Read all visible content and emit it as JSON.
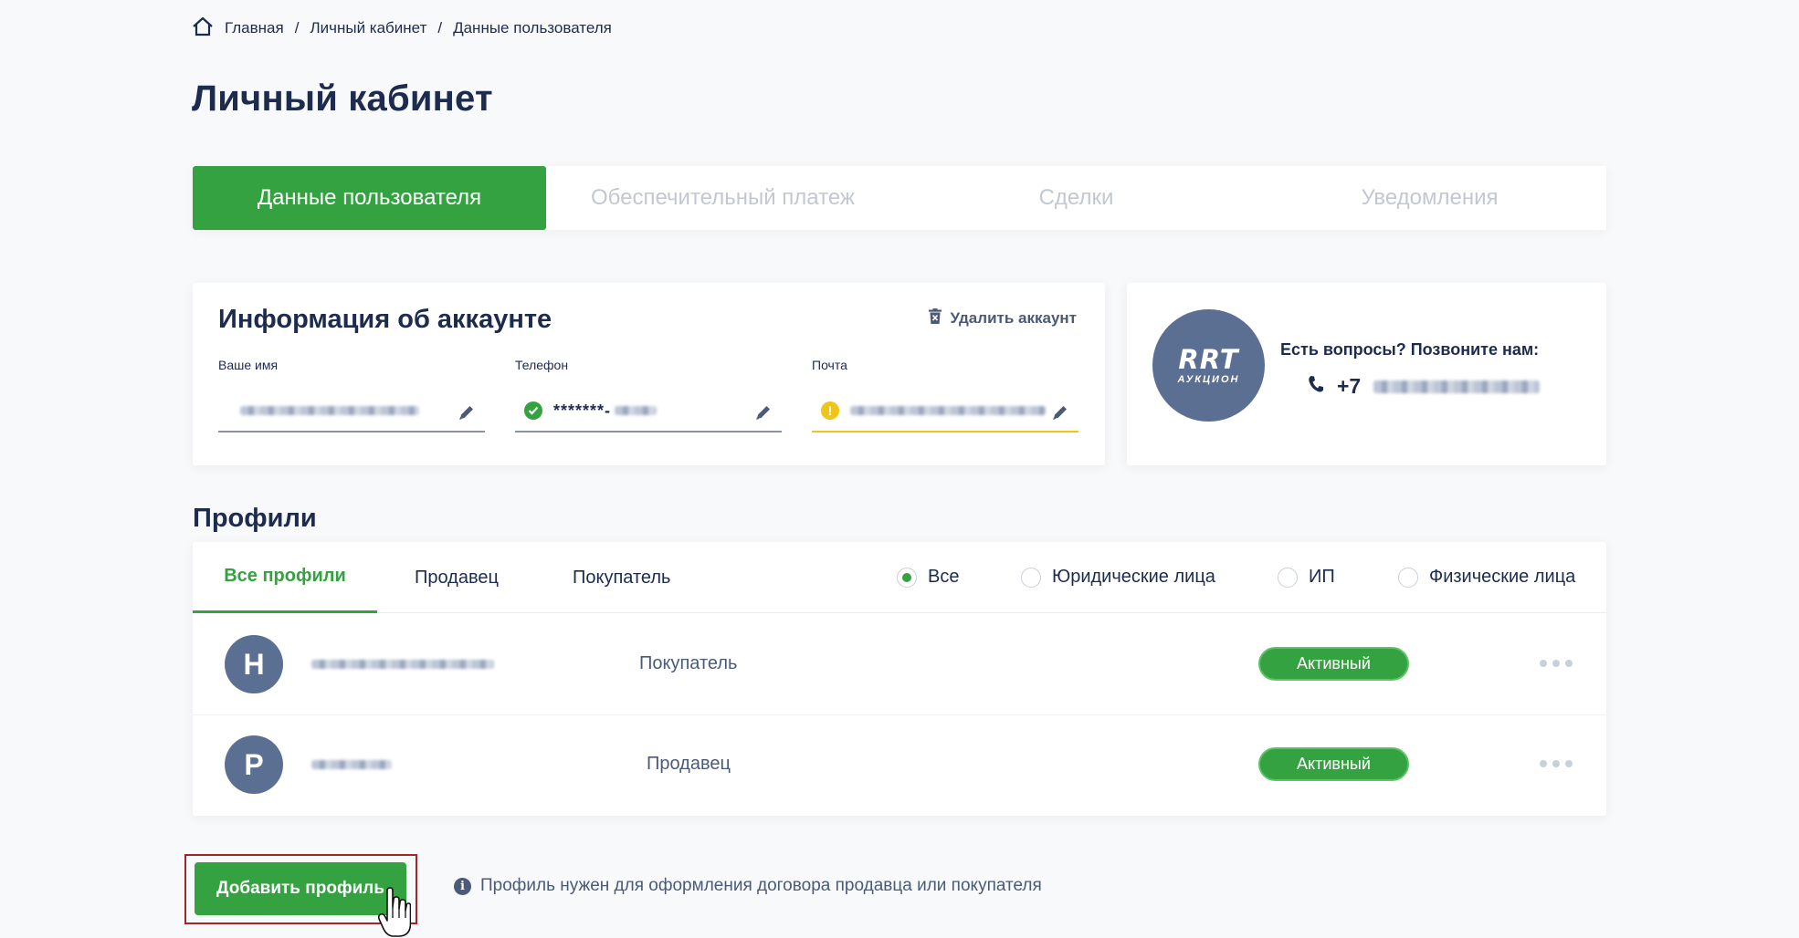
{
  "breadcrumb": {
    "home": "Главная",
    "section": "Личный кабинет",
    "current": "Данные пользователя",
    "separator": "/"
  },
  "page_title": "Личный кабинет",
  "tabs": [
    {
      "label": "Данные пользователя",
      "active": true
    },
    {
      "label": "Обеспечительный платеж",
      "active": false
    },
    {
      "label": "Сделки",
      "active": false
    },
    {
      "label": "Уведомления",
      "active": false
    }
  ],
  "account": {
    "title": "Информация об аккаунте",
    "delete_label": "Удалить аккаунт",
    "fields": [
      {
        "label": "Ваше имя",
        "value": "",
        "status": "none"
      },
      {
        "label": "Телефон",
        "value": "*******-",
        "status": "verified"
      },
      {
        "label": "Почта",
        "value": "",
        "status": "warning"
      }
    ]
  },
  "contact": {
    "logo_main": "RRT",
    "logo_sub": "АУКЦИОН",
    "question": "Есть вопросы? Позвоните нам:",
    "phone_prefix": "+7"
  },
  "profiles": {
    "title": "Профили",
    "tabs": [
      "Все профили",
      "Продавец",
      "Покупатель"
    ],
    "active_tab": "Все профили",
    "filters": [
      "Все",
      "Юридические лица",
      "ИП",
      "Физические лица"
    ],
    "selected_filter": "Все",
    "rows": [
      {
        "initial": "Н",
        "role": "Покупатель",
        "status": "Активный"
      },
      {
        "initial": "Р",
        "role": "Продавец",
        "status": "Активный"
      }
    ]
  },
  "add_profile_label": "Добавить профиль",
  "hint": "Профиль нужен для оформления договора продавца или покупателя",
  "colors": {
    "accent": "#35a241",
    "primary_text": "#1d2b4f",
    "avatar": "#5b6f93",
    "warning": "#f0c419"
  }
}
